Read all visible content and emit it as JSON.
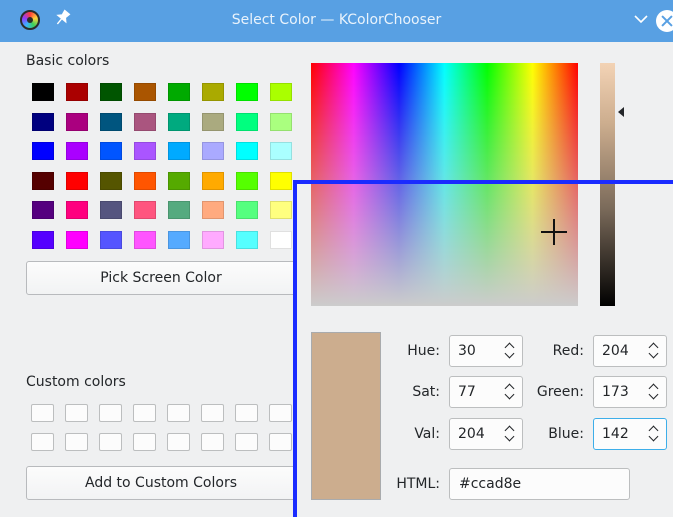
{
  "window": {
    "title": "Select Color — KColorChooser",
    "icons": {
      "app": "kcolorchooser-icon",
      "pin": "pin-icon",
      "collapse": "chevron-down-icon",
      "close": "close-icon"
    }
  },
  "basic": {
    "label": "Basic colors",
    "colors": [
      [
        "#000000",
        "#aa0000",
        "#005500",
        "#aa5500",
        "#00aa00",
        "#aaaa00",
        "#00ff00",
        "#aaff00"
      ],
      [
        "#00007f",
        "#aa007f",
        "#00557f",
        "#aa557f",
        "#00aa7f",
        "#aaaa7f",
        "#00ff7f",
        "#aaff7f"
      ],
      [
        "#0000ff",
        "#aa00ff",
        "#0055ff",
        "#aa55ff",
        "#00aaff",
        "#aaaaff",
        "#00ffff",
        "#aaffff"
      ],
      [
        "#550000",
        "#ff0000",
        "#555500",
        "#ff5500",
        "#55aa00",
        "#ffaa00",
        "#55ff00",
        "#ffff00"
      ],
      [
        "#55007f",
        "#ff007f",
        "#55557f",
        "#ff557f",
        "#55aa7f",
        "#ffaa7f",
        "#55ff7f",
        "#ffff7f"
      ],
      [
        "#5500ff",
        "#ff00ff",
        "#5555ff",
        "#ff55ff",
        "#55aaff",
        "#ffaaff",
        "#55ffff",
        "#ffffff"
      ]
    ]
  },
  "pick_button": "Pick Screen Color",
  "custom": {
    "label": "Custom colors",
    "rows": 2,
    "cols": 8
  },
  "add_button": "Add to Custom Colors",
  "current_color": "#ccad8e",
  "fields": {
    "hue": {
      "label": "Hue:",
      "value": "30"
    },
    "sat": {
      "label": "Sat:",
      "value": "77"
    },
    "val": {
      "label": "Val:",
      "value": "204"
    },
    "red": {
      "label": "Red:",
      "value": "204"
    },
    "green": {
      "label": "Green:",
      "value": "173"
    },
    "blue": {
      "label": "Blue:",
      "value": "142"
    }
  },
  "html": {
    "label": "HTML:",
    "value": "#ccad8e"
  },
  "highlight_color": "#1a2bff"
}
